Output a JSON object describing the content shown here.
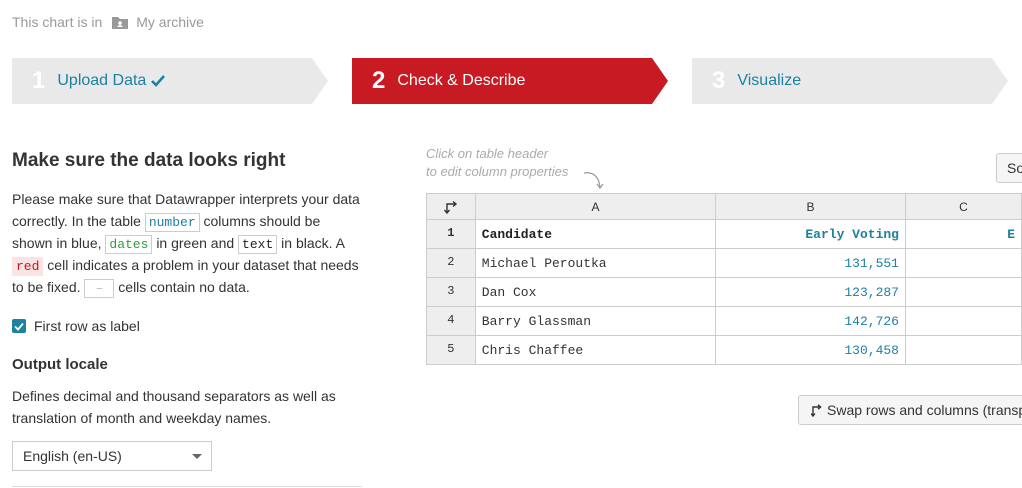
{
  "breadcrumb": {
    "prefix": "This chart is in",
    "folder": "My archive"
  },
  "steps": [
    {
      "num": "1",
      "label": "Upload Data",
      "state": "done"
    },
    {
      "num": "2",
      "label": "Check & Describe",
      "state": "active"
    },
    {
      "num": "3",
      "label": "Visualize",
      "state": "todo"
    }
  ],
  "left": {
    "title": "Make sure the data looks right",
    "desc_1": "Please make sure that Datawrapper interprets your data correctly. In the table",
    "tag_number": "number",
    "desc_2": "columns should be shown in blue,",
    "tag_dates": "dates",
    "desc_3": "in green and",
    "tag_text": "text",
    "desc_4": "in black. A",
    "tag_red": "red",
    "desc_5": "cell indicates a problem in your dataset that needs to be fixed.",
    "tag_empty": "–",
    "desc_6": "cells contain no data.",
    "first_row_label": "First row as label",
    "locale_title": "Output locale",
    "locale_desc": "Defines decimal and thousand separators as well as translation of month and weekday names.",
    "locale_value": "English (en-US)"
  },
  "hint": {
    "line1": "Click on table header",
    "line2": "to edit column properties"
  },
  "sort_button": "So",
  "table": {
    "columns": [
      "A",
      "B",
      "C"
    ],
    "rows": [
      {
        "n": "1",
        "a": "Candidate",
        "b": "Early Voting",
        "c": "E"
      },
      {
        "n": "2",
        "a": "Michael Peroutka",
        "b": "131,551",
        "c": ""
      },
      {
        "n": "3",
        "a": "Dan Cox",
        "b": "123,287",
        "c": ""
      },
      {
        "n": "4",
        "a": "Barry Glassman",
        "b": "142,726",
        "c": ""
      },
      {
        "n": "5",
        "a": "Chris Chaffee",
        "b": "130,458",
        "c": ""
      }
    ]
  },
  "swap_button": "Swap rows and columns (transpose)",
  "colors": {
    "accent": "#1d81a2",
    "active_step": "#c71a23"
  }
}
